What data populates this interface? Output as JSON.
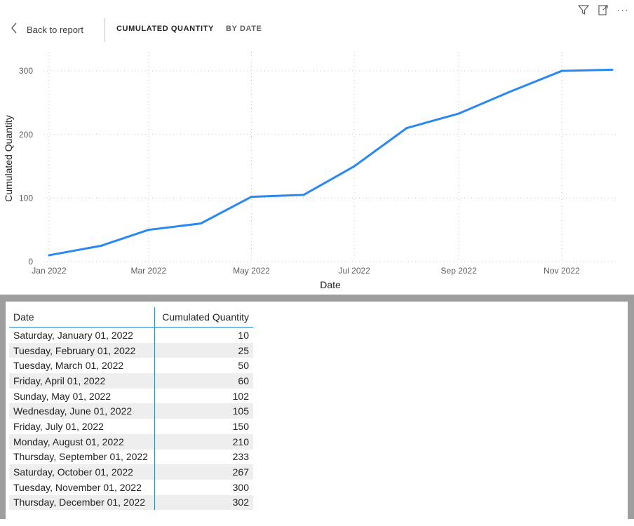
{
  "toolbar": {
    "icons": [
      "filter-icon",
      "focus-mode-icon",
      "more-options-icon"
    ],
    "more_label": "···"
  },
  "header": {
    "back_label": "Back to report",
    "tabs": [
      {
        "label": "CUMULATED QUANTITY",
        "active": true
      },
      {
        "label": "BY DATE",
        "active": false
      }
    ]
  },
  "chart_data": {
    "type": "line",
    "title": "",
    "xlabel": "Date",
    "ylabel": "Cumulated Quantity",
    "x": [
      "2022-01-01",
      "2022-02-01",
      "2022-03-01",
      "2022-04-01",
      "2022-05-01",
      "2022-06-01",
      "2022-07-01",
      "2022-08-01",
      "2022-09-01",
      "2022-10-01",
      "2022-11-01",
      "2022-12-01"
    ],
    "x_ticks": [
      "Jan 2022",
      "Mar 2022",
      "May 2022",
      "Jul 2022",
      "Sep 2022",
      "Nov 2022"
    ],
    "y_ticks": [
      0,
      100,
      200,
      300
    ],
    "ylim": [
      0,
      330
    ],
    "grid": true,
    "series": [
      {
        "values": [
          10,
          25,
          50,
          60,
          102,
          105,
          150,
          210,
          233,
          267,
          300,
          302
        ],
        "color": "#2b88ef"
      }
    ]
  },
  "table": {
    "columns": [
      "Date",
      "Cumulated Quantity"
    ],
    "rows": [
      [
        "Saturday, January 01, 2022",
        "10"
      ],
      [
        "Tuesday, February 01, 2022",
        "25"
      ],
      [
        "Tuesday, March 01, 2022",
        "50"
      ],
      [
        "Friday, April 01, 2022",
        "60"
      ],
      [
        "Sunday, May 01, 2022",
        "102"
      ],
      [
        "Wednesday, June 01, 2022",
        "105"
      ],
      [
        "Friday, July 01, 2022",
        "150"
      ],
      [
        "Monday, August 01, 2022",
        "210"
      ],
      [
        "Thursday, September 01, 2022",
        "233"
      ],
      [
        "Saturday, October 01, 2022",
        "267"
      ],
      [
        "Tuesday, November 01, 2022",
        "300"
      ],
      [
        "Thursday, December 01, 2022",
        "302"
      ]
    ]
  }
}
